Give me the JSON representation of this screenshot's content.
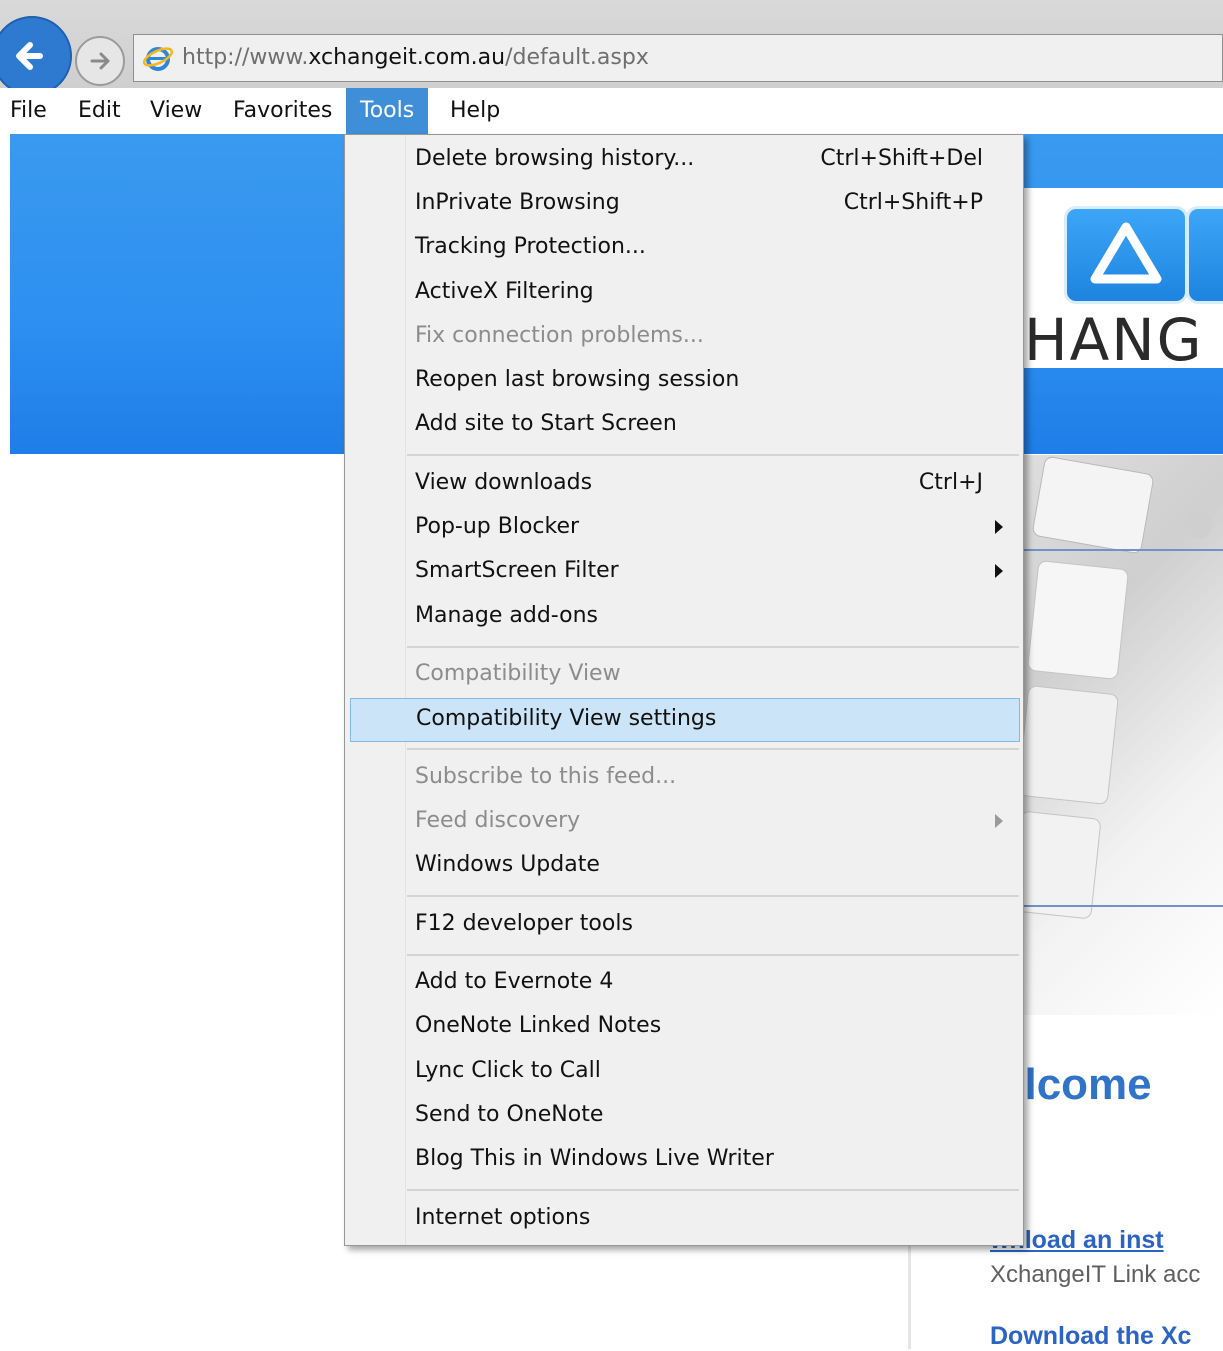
{
  "address_bar": {
    "url_prefix": "http://www.",
    "url_host": "xchangeit.com.au",
    "url_path": "/default.aspx",
    "icon": "ie-icon"
  },
  "nav": {
    "back_icon": "back-arrow-icon",
    "forward_icon": "forward-arrow-icon"
  },
  "menubar": {
    "items": [
      "File",
      "Edit",
      "View",
      "Favorites",
      "Tools",
      "Help"
    ],
    "active": "Tools"
  },
  "tools_menu": {
    "items": [
      {
        "label": "Delete browsing history...",
        "shortcut": "Ctrl+Shift+Del"
      },
      {
        "label": "InPrivate Browsing",
        "shortcut": "Ctrl+Shift+P"
      },
      {
        "label": "Tracking Protection..."
      },
      {
        "label": "ActiveX Filtering"
      },
      {
        "label": "Fix connection problems...",
        "disabled": true
      },
      {
        "label": "Reopen last browsing session"
      },
      {
        "label": "Add site to Start Screen"
      },
      {
        "label": "View downloads",
        "shortcut": "Ctrl+J"
      },
      {
        "label": "Pop-up Blocker",
        "submenu": true
      },
      {
        "label": "SmartScreen Filter",
        "submenu": true
      },
      {
        "label": "Manage add-ons"
      },
      {
        "label": "Compatibility View",
        "disabled": true
      },
      {
        "label": "Compatibility View settings",
        "highlighted": true
      },
      {
        "label": "Subscribe to this feed...",
        "disabled": true
      },
      {
        "label": "Feed discovery",
        "disabled": true,
        "submenu": true
      },
      {
        "label": "Windows Update"
      },
      {
        "label": "F12 developer tools"
      },
      {
        "label": "Add to Evernote 4"
      },
      {
        "label": "OneNote Linked Notes"
      },
      {
        "label": "Lync Click to Call"
      },
      {
        "label": "Send to OneNote"
      },
      {
        "label": "Blog This in Windows Live Writer"
      },
      {
        "label": "Internet options"
      }
    ]
  },
  "page": {
    "logo_text": "HANG",
    "welcome": "elcome",
    "link1": "wnload an inst",
    "desc1": "XchangeIT Link acc",
    "link2": "Download the Xc"
  },
  "colors": {
    "menu_active": "#3f8fd8",
    "banner": "#2d8ff0",
    "highlight": "#cce4f7",
    "link": "#2b64c3"
  }
}
